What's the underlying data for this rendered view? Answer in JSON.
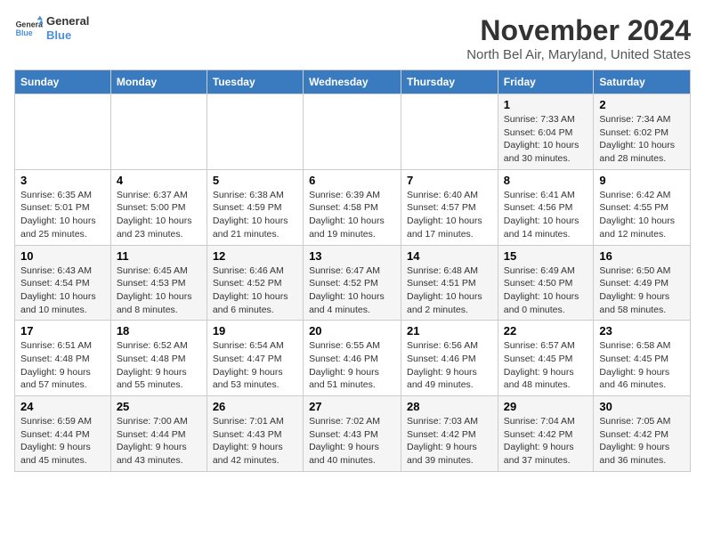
{
  "logo": {
    "text_general": "General",
    "text_blue": "Blue"
  },
  "header": {
    "month": "November 2024",
    "location": "North Bel Air, Maryland, United States"
  },
  "weekdays": [
    "Sunday",
    "Monday",
    "Tuesday",
    "Wednesday",
    "Thursday",
    "Friday",
    "Saturday"
  ],
  "weeks": [
    [
      {
        "day": "",
        "info": ""
      },
      {
        "day": "",
        "info": ""
      },
      {
        "day": "",
        "info": ""
      },
      {
        "day": "",
        "info": ""
      },
      {
        "day": "",
        "info": ""
      },
      {
        "day": "1",
        "info": "Sunrise: 7:33 AM\nSunset: 6:04 PM\nDaylight: 10 hours and 30 minutes."
      },
      {
        "day": "2",
        "info": "Sunrise: 7:34 AM\nSunset: 6:02 PM\nDaylight: 10 hours and 28 minutes."
      }
    ],
    [
      {
        "day": "3",
        "info": "Sunrise: 6:35 AM\nSunset: 5:01 PM\nDaylight: 10 hours and 25 minutes."
      },
      {
        "day": "4",
        "info": "Sunrise: 6:37 AM\nSunset: 5:00 PM\nDaylight: 10 hours and 23 minutes."
      },
      {
        "day": "5",
        "info": "Sunrise: 6:38 AM\nSunset: 4:59 PM\nDaylight: 10 hours and 21 minutes."
      },
      {
        "day": "6",
        "info": "Sunrise: 6:39 AM\nSunset: 4:58 PM\nDaylight: 10 hours and 19 minutes."
      },
      {
        "day": "7",
        "info": "Sunrise: 6:40 AM\nSunset: 4:57 PM\nDaylight: 10 hours and 17 minutes."
      },
      {
        "day": "8",
        "info": "Sunrise: 6:41 AM\nSunset: 4:56 PM\nDaylight: 10 hours and 14 minutes."
      },
      {
        "day": "9",
        "info": "Sunrise: 6:42 AM\nSunset: 4:55 PM\nDaylight: 10 hours and 12 minutes."
      }
    ],
    [
      {
        "day": "10",
        "info": "Sunrise: 6:43 AM\nSunset: 4:54 PM\nDaylight: 10 hours and 10 minutes."
      },
      {
        "day": "11",
        "info": "Sunrise: 6:45 AM\nSunset: 4:53 PM\nDaylight: 10 hours and 8 minutes."
      },
      {
        "day": "12",
        "info": "Sunrise: 6:46 AM\nSunset: 4:52 PM\nDaylight: 10 hours and 6 minutes."
      },
      {
        "day": "13",
        "info": "Sunrise: 6:47 AM\nSunset: 4:52 PM\nDaylight: 10 hours and 4 minutes."
      },
      {
        "day": "14",
        "info": "Sunrise: 6:48 AM\nSunset: 4:51 PM\nDaylight: 10 hours and 2 minutes."
      },
      {
        "day": "15",
        "info": "Sunrise: 6:49 AM\nSunset: 4:50 PM\nDaylight: 10 hours and 0 minutes."
      },
      {
        "day": "16",
        "info": "Sunrise: 6:50 AM\nSunset: 4:49 PM\nDaylight: 9 hours and 58 minutes."
      }
    ],
    [
      {
        "day": "17",
        "info": "Sunrise: 6:51 AM\nSunset: 4:48 PM\nDaylight: 9 hours and 57 minutes."
      },
      {
        "day": "18",
        "info": "Sunrise: 6:52 AM\nSunset: 4:48 PM\nDaylight: 9 hours and 55 minutes."
      },
      {
        "day": "19",
        "info": "Sunrise: 6:54 AM\nSunset: 4:47 PM\nDaylight: 9 hours and 53 minutes."
      },
      {
        "day": "20",
        "info": "Sunrise: 6:55 AM\nSunset: 4:46 PM\nDaylight: 9 hours and 51 minutes."
      },
      {
        "day": "21",
        "info": "Sunrise: 6:56 AM\nSunset: 4:46 PM\nDaylight: 9 hours and 49 minutes."
      },
      {
        "day": "22",
        "info": "Sunrise: 6:57 AM\nSunset: 4:45 PM\nDaylight: 9 hours and 48 minutes."
      },
      {
        "day": "23",
        "info": "Sunrise: 6:58 AM\nSunset: 4:45 PM\nDaylight: 9 hours and 46 minutes."
      }
    ],
    [
      {
        "day": "24",
        "info": "Sunrise: 6:59 AM\nSunset: 4:44 PM\nDaylight: 9 hours and 45 minutes."
      },
      {
        "day": "25",
        "info": "Sunrise: 7:00 AM\nSunset: 4:44 PM\nDaylight: 9 hours and 43 minutes."
      },
      {
        "day": "26",
        "info": "Sunrise: 7:01 AM\nSunset: 4:43 PM\nDaylight: 9 hours and 42 minutes."
      },
      {
        "day": "27",
        "info": "Sunrise: 7:02 AM\nSunset: 4:43 PM\nDaylight: 9 hours and 40 minutes."
      },
      {
        "day": "28",
        "info": "Sunrise: 7:03 AM\nSunset: 4:42 PM\nDaylight: 9 hours and 39 minutes."
      },
      {
        "day": "29",
        "info": "Sunrise: 7:04 AM\nSunset: 4:42 PM\nDaylight: 9 hours and 37 minutes."
      },
      {
        "day": "30",
        "info": "Sunrise: 7:05 AM\nSunset: 4:42 PM\nDaylight: 9 hours and 36 minutes."
      }
    ]
  ]
}
